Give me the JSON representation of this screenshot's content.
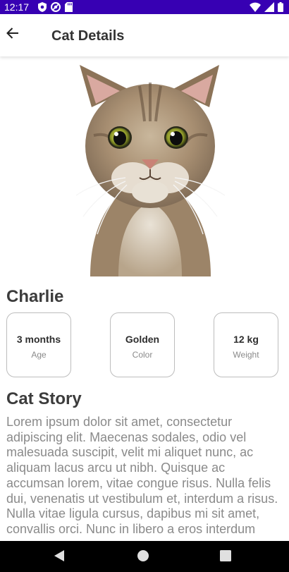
{
  "status_bar": {
    "time": "12:17",
    "left_icons": [
      "shield-icon",
      "at-sign-icon",
      "sd-card-icon"
    ],
    "right_icons": [
      "wifi-icon",
      "signal-icon",
      "battery-icon"
    ],
    "background": "#3700b3"
  },
  "app_bar": {
    "title": "Cat Details",
    "back_icon": "arrow-back-icon"
  },
  "cat": {
    "name": "Charlie",
    "info": [
      {
        "value": "3 months",
        "label": "Age"
      },
      {
        "value": "Golden",
        "label": "Color"
      },
      {
        "value": "12 kg",
        "label": "Weight"
      }
    ]
  },
  "story": {
    "heading": "Cat Story",
    "text": "Lorem ipsum dolor sit amet, consectetur adipiscing elit. Maecenas sodales, odio vel malesuada suscipit, velit mi aliquet nunc, ac aliquam lacus arcu ut nibh. Quisque ac accumsan lorem, vitae congue risus. Nulla felis dui, venenatis ut vestibulum et, interdum a risus. Nulla vitae ligula cursus, dapibus mi sit amet, convallis orci. Nunc in libero a eros interdum"
  },
  "nav_bar": {
    "buttons": [
      "back-triangle-icon",
      "home-circle-icon",
      "recents-square-icon"
    ]
  }
}
